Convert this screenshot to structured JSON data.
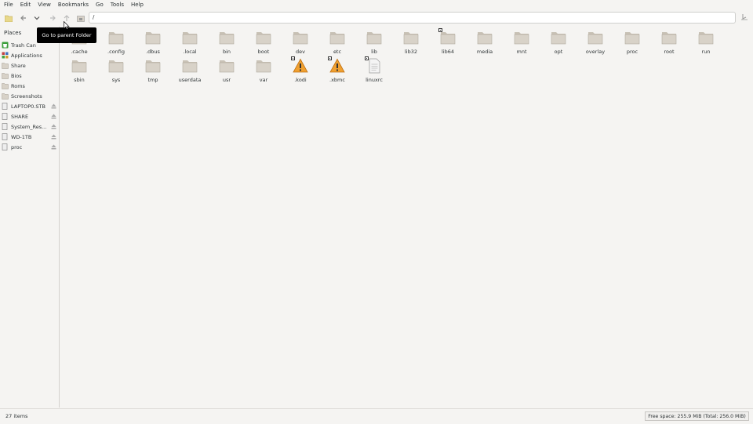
{
  "menubar": {
    "items": [
      "File",
      "Edit",
      "View",
      "Bookmarks",
      "Go",
      "Tools",
      "Help"
    ]
  },
  "toolbar": {
    "location": "/",
    "tooltip": "Go to parent Folder"
  },
  "sidebar": {
    "heading": "Places",
    "items": [
      {
        "label": "Trash Can",
        "icon": "trash-icon",
        "eject": false
      },
      {
        "label": "Applications",
        "icon": "applications-icon",
        "eject": false
      },
      {
        "label": "Share",
        "icon": "folder-icon",
        "eject": false
      },
      {
        "label": "Bios",
        "icon": "folder-icon",
        "eject": false
      },
      {
        "label": "Roms",
        "icon": "folder-icon",
        "eject": false
      },
      {
        "label": "Screenshots",
        "icon": "folder-icon",
        "eject": false
      },
      {
        "label": "LAPTOP0.STB",
        "icon": "drive-icon",
        "eject": true
      },
      {
        "label": "SHARE",
        "icon": "drive-icon",
        "eject": true
      },
      {
        "label": "System_Res...",
        "icon": "drive-icon",
        "eject": true
      },
      {
        "label": "WD-1TB",
        "icon": "drive-icon",
        "eject": true
      },
      {
        "label": "proc",
        "icon": "drive-icon",
        "eject": true
      }
    ]
  },
  "files": [
    {
      "name": ".cache",
      "type": "folder"
    },
    {
      "name": ".config",
      "type": "folder"
    },
    {
      "name": ".dbus",
      "type": "folder"
    },
    {
      "name": ".local",
      "type": "folder"
    },
    {
      "name": "bin",
      "type": "folder"
    },
    {
      "name": "boot",
      "type": "folder"
    },
    {
      "name": "dev",
      "type": "folder"
    },
    {
      "name": "etc",
      "type": "folder"
    },
    {
      "name": "lib",
      "type": "folder"
    },
    {
      "name": "lib32",
      "type": "folder"
    },
    {
      "name": "lib64",
      "type": "folder-link"
    },
    {
      "name": "media",
      "type": "folder"
    },
    {
      "name": "mnt",
      "type": "folder"
    },
    {
      "name": "opt",
      "type": "folder"
    },
    {
      "name": "overlay",
      "type": "folder"
    },
    {
      "name": "proc",
      "type": "folder"
    },
    {
      "name": "root",
      "type": "folder"
    },
    {
      "name": "run",
      "type": "folder"
    },
    {
      "name": "sbin",
      "type": "folder"
    },
    {
      "name": "sys",
      "type": "folder"
    },
    {
      "name": "tmp",
      "type": "folder"
    },
    {
      "name": "userdata",
      "type": "folder"
    },
    {
      "name": "usr",
      "type": "folder"
    },
    {
      "name": "var",
      "type": "folder"
    },
    {
      "name": ".kodi",
      "type": "broken-link"
    },
    {
      "name": ".xbmc",
      "type": "broken-link"
    },
    {
      "name": "linuxrc",
      "type": "file-link"
    }
  ],
  "status": {
    "count": "27 items",
    "free_space": "Free space: 255.9 MiB (Total: 256.0 MiB)"
  },
  "colors": {
    "folder": "#d8d2c8",
    "folder_tab": "#c9c2b6",
    "warning": "#f0a030"
  }
}
